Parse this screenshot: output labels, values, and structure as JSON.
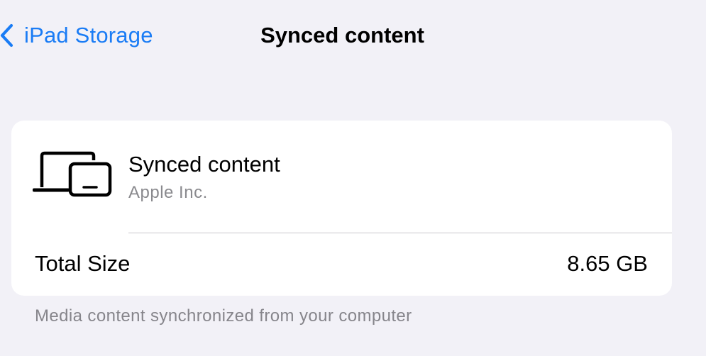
{
  "nav": {
    "back_label": "iPad Storage",
    "back_icon": "chevron-left-icon",
    "title": "Synced content"
  },
  "app": {
    "icon": "laptop-and-ipad-icon",
    "name": "Synced content",
    "developer": "Apple Inc."
  },
  "size": {
    "label": "Total Size",
    "value": "8.65 GB"
  },
  "footnote": "Media content synchronized from your computer",
  "colors": {
    "background": "#f2f1f7",
    "accent": "#1a7cf5",
    "card": "#ffffff",
    "secondary_text": "#8a8a8e"
  }
}
